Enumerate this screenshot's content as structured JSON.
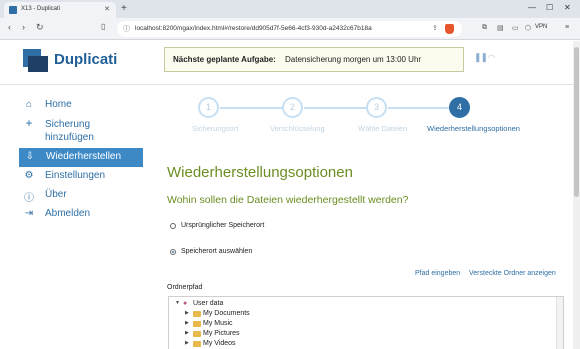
{
  "browser": {
    "tab_title": "X13 - Duplicati",
    "new_tab": "+",
    "url": "localhost:8200/ngax/index.html#/restore/dd905d7f-5e66-4cf3-930d-a2432c67b18a",
    "vpn_label": "VPN"
  },
  "header": {
    "logo": "Duplicati",
    "schedule_label": "Nächste geplante Aufgabe:",
    "schedule_value": "Datensicherung morgen um 13:00 Uhr"
  },
  "sidebar": {
    "items": [
      {
        "label": "Home",
        "icon": "home-icon"
      },
      {
        "label": "Sicherung hinzufügen",
        "icon": "plus-icon"
      },
      {
        "label": "Wiederherstellen",
        "icon": "restore-icon"
      },
      {
        "label": "Einstellungen",
        "icon": "gear-icon"
      },
      {
        "label": "Über",
        "icon": "info-icon"
      },
      {
        "label": "Abmelden",
        "icon": "logout-icon"
      }
    ],
    "active": "Wiederherstellen"
  },
  "wizard": {
    "steps": [
      {
        "num": "1",
        "label": "Sicherungsort"
      },
      {
        "num": "2",
        "label": "Verschlüsselung"
      },
      {
        "num": "3",
        "label": "Wähle Dateien"
      },
      {
        "num": "4",
        "label": "Wiederherstellungsoptionen"
      }
    ],
    "current": 4
  },
  "main": {
    "title": "Wiederherstellungsoptionen",
    "question": "Wohin sollen die Dateien wiederhergestellt werden?",
    "option_original": "Ursprünglicher Speicherort",
    "option_choose": "Speicherort auswählen",
    "selected_option": "Speicherort auswählen",
    "link_enter_path": "Pfad eingeben",
    "link_hidden_folders": "Versteckte Ordner anzeigen",
    "folder_path_label": "Ordnerpfad"
  },
  "tree": {
    "root": "User data",
    "children": [
      "My Documents",
      "My Music",
      "My Pictures",
      "My Videos"
    ]
  },
  "colors": {
    "brand": "#2f6fa5",
    "active_nav": "#3d89c6",
    "heading_green": "#6b8e23"
  }
}
